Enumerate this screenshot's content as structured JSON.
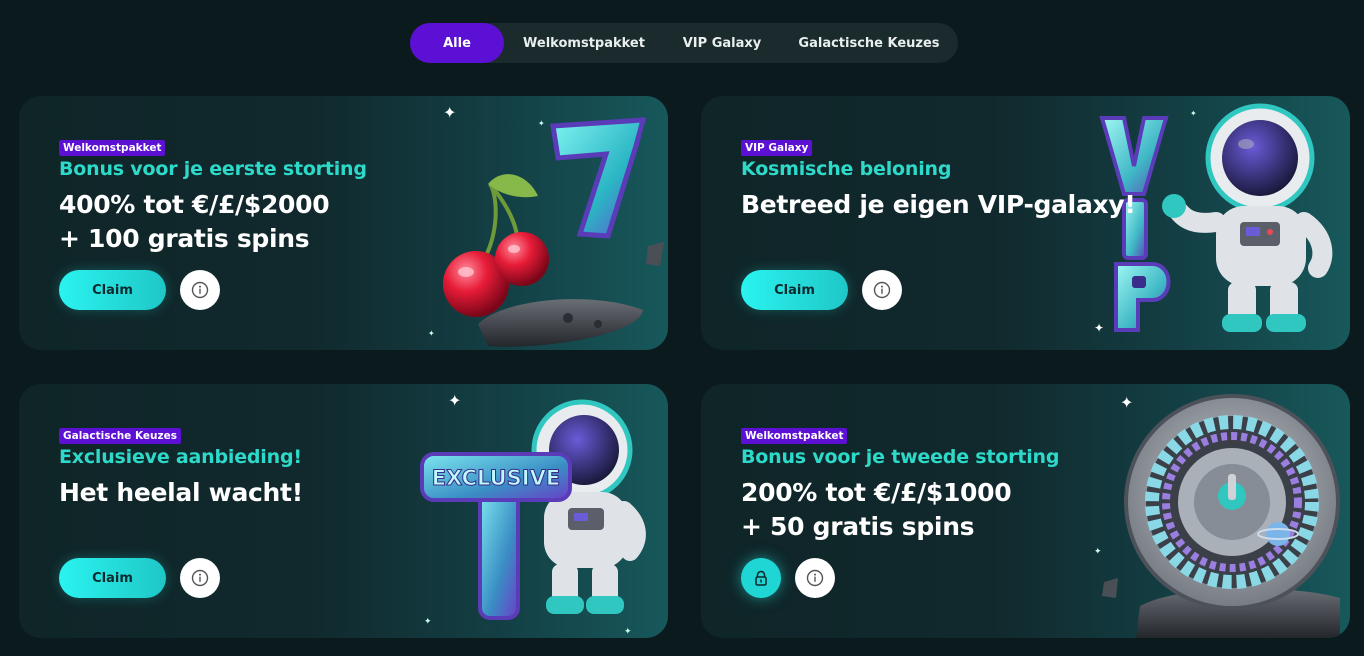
{
  "tabs": [
    {
      "label": "Alle",
      "active": true
    },
    {
      "label": "Welkomstpakket",
      "active": false
    },
    {
      "label": "VIP Galaxy",
      "active": false
    },
    {
      "label": "Galactische Keuzes",
      "active": false
    }
  ],
  "cards": [
    {
      "badge": "Welkomstpakket",
      "subtitle": "Bonus voor je eerste storting",
      "line1": "400% tot €/£/$2000",
      "line2": "+ 100 gratis spins",
      "claim_label": "Claim",
      "art": "cherries-seven-illustration"
    },
    {
      "badge": "VIP Galaxy",
      "subtitle": "Kosmische beloning",
      "line1": "Betreed je eigen VIP-galaxy!",
      "line2": "",
      "claim_label": "Claim",
      "art": "astronaut-vip-illustration"
    },
    {
      "badge": "Galactische Keuzes",
      "subtitle": "Exclusieve aanbieding!",
      "line1": "Het heelal wacht!",
      "line2": "",
      "claim_label": "Claim",
      "art": "astronaut-exclusive-illustration",
      "art_text": "EXCLUSIVE"
    },
    {
      "badge": "Welkomstpakket",
      "subtitle": "Bonus voor je tweede storting",
      "line1": "200% tot €/£/$1000",
      "line2": "+ 50 gratis spins",
      "locked": true,
      "art": "roulette-wheel-illustration"
    }
  ],
  "colors": {
    "accent_purple": "#5b10d4",
    "accent_teal": "#2dd9c8",
    "button_cyan": "#2af3ef",
    "background": "#0b1a1d"
  }
}
